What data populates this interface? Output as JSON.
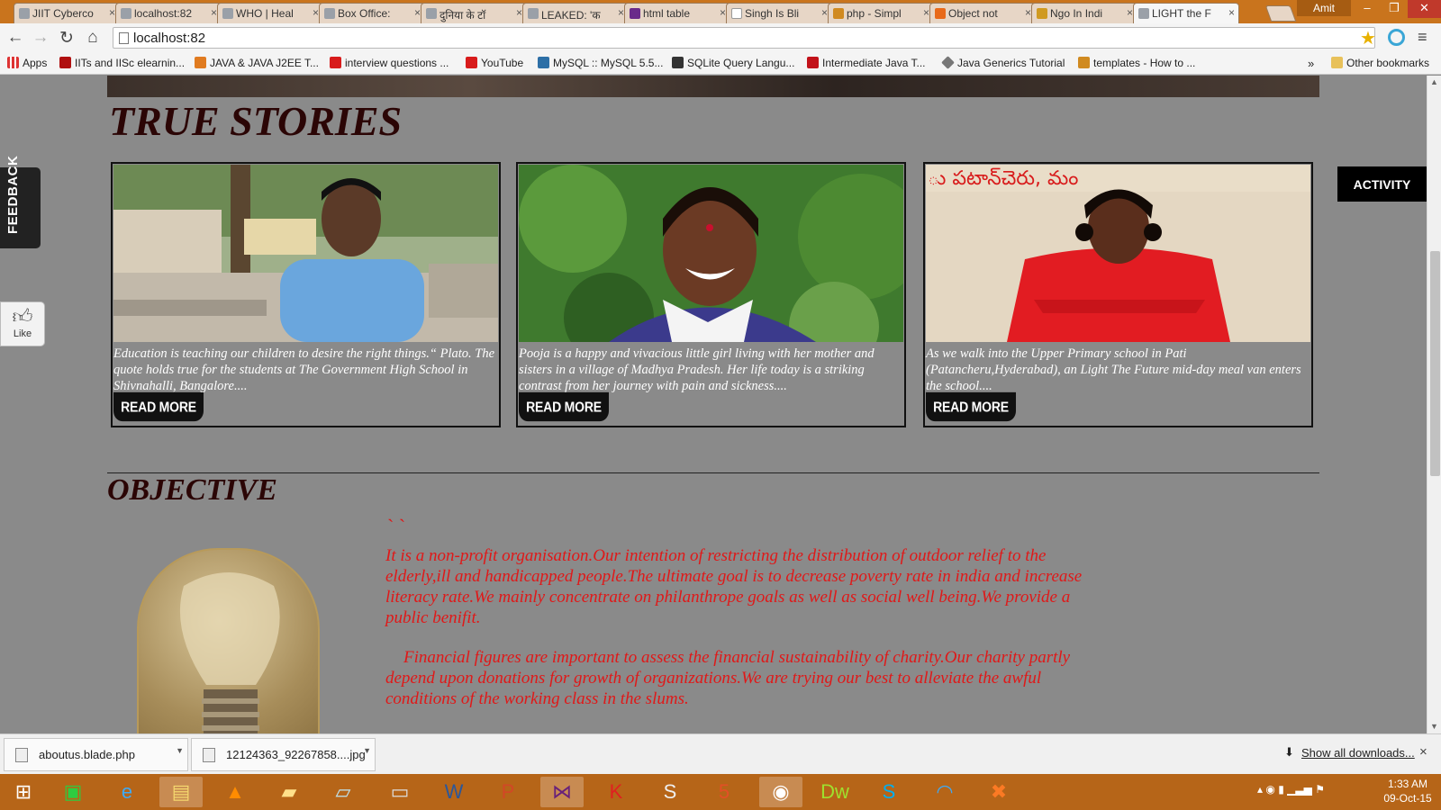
{
  "browser": {
    "tabs": [
      {
        "label": "JIIT Cyberco",
        "active": false
      },
      {
        "label": "localhost:82",
        "active": false
      },
      {
        "label": "WHO | Heal",
        "active": false
      },
      {
        "label": "Box Office:",
        "active": false
      },
      {
        "label": "दुनिया के टॉ",
        "active": false
      },
      {
        "label": "LEAKED: 'क",
        "active": false
      },
      {
        "label": "html table",
        "active": false
      },
      {
        "label": "Singh Is Bli",
        "active": false
      },
      {
        "label": "php - Simpl",
        "active": false
      },
      {
        "label": "Object not",
        "active": false
      },
      {
        "label": "Ngo In Indi",
        "active": false
      },
      {
        "label": "LIGHT the F",
        "active": true
      }
    ],
    "user": "Amit",
    "address": "localhost:82",
    "bookmarks": [
      {
        "label": "Apps",
        "color": "#d33"
      },
      {
        "label": "IITs and IISc elearnin...",
        "color": "#b01010"
      },
      {
        "label": "JAVA & JAVA J2EE T...",
        "color": "#e07b20"
      },
      {
        "label": "interview questions ...",
        "color": "#d81b1b"
      },
      {
        "label": "YouTube",
        "color": "#d81b1b"
      },
      {
        "label": "MySQL :: MySQL 5.5...",
        "color": "#2d6fa6"
      },
      {
        "label": "SQLite Query Langu...",
        "color": "#333"
      },
      {
        "label": "Intermediate Java T...",
        "color": "#c2121a"
      },
      {
        "label": "Java Generics Tutorial",
        "color": "#777"
      },
      {
        "label": "templates - How to ...",
        "color": "#d08a20"
      }
    ],
    "bookmarks_overflow": "»",
    "other_bookmarks": "Other bookmarks"
  },
  "page": {
    "true_stories_title": "TRUE STORIES",
    "stories": [
      {
        "caption": "Education is teaching our children to desire the right things.“ Plato. The quote holds true for the students at The Government High School in Shivnahalli, Bangalore....",
        "button": "READ MORE"
      },
      {
        "caption": "Pooja is a happy and vivacious little girl living with her mother and sisters in a village of Madhya Pradesh. Her life today is a striking contrast from her journey with pain and sickness....",
        "button": "READ MORE"
      },
      {
        "caption": "As we walk into the Upper Primary school in Pati (Patancheru,Hyderabad), an Light The Future mid-day meal van enters the school....",
        "button": "READ MORE"
      }
    ],
    "photo3_text": "ు పటాన్‌చెరు, మం",
    "objective_title": "OBJECTIVE",
    "quote_marks": "` `",
    "objective_para1": "It is a non-profit organisation.Our intention of restricting the distribution of outdoor relief to the elderly,ill and handicapped people.The ultimate goal is to decrease poverty rate in india and increase literacy rate.We mainly concentrate on philanthrope goals as well as social well being.We provide a public benifit.",
    "objective_para2": "Financial figures are important to assess the financial sustainability of charity.Our charity partly depend upon donations for growth of organizations.We are trying our best to alleviate the awful conditions of the working class in the slums.",
    "feedback_label": "FEEDBACK",
    "like_label": "Like",
    "activity_label": "ACTIVITY"
  },
  "downloads": {
    "items": [
      "aboutus.blade.php",
      "12124363_92267858....jpg"
    ],
    "show_all": "Show all downloads...",
    "close": "×"
  },
  "taskbar": {
    "time": "1:33 AM",
    "date": "09-Oct-15"
  },
  "colors": {
    "page_bg": "#8a8a8a",
    "title": "#2b0505",
    "objective_text": "#e01818",
    "taskbar": "#b66518"
  }
}
